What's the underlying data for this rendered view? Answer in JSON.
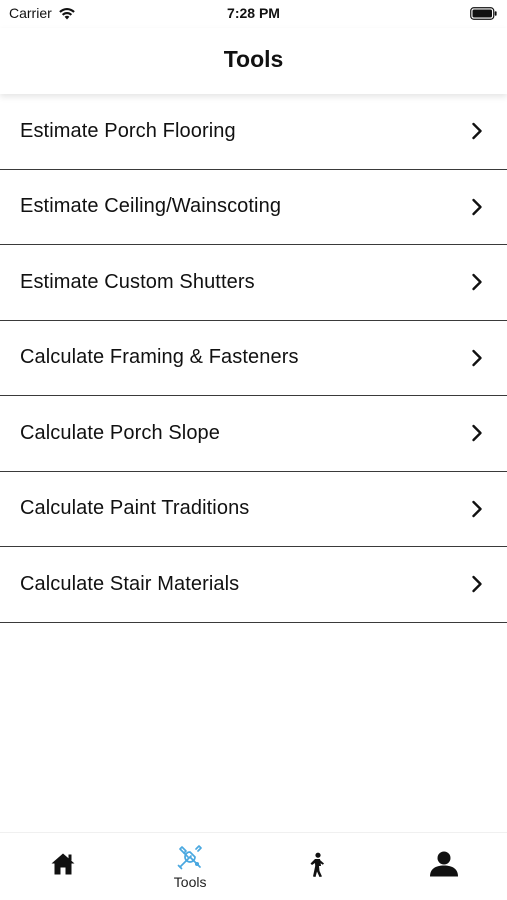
{
  "status_bar": {
    "carrier": "Carrier",
    "time": "7:28 PM"
  },
  "header": {
    "title": "Tools"
  },
  "tools": [
    {
      "label": "Estimate Porch Flooring"
    },
    {
      "label": "Estimate Ceiling/Wainscoting"
    },
    {
      "label": "Estimate Custom Shutters"
    },
    {
      "label": "Calculate Framing & Fasteners"
    },
    {
      "label": "Calculate Porch Slope"
    },
    {
      "label": "Calculate Paint Traditions"
    },
    {
      "label": "Calculate Stair Materials"
    }
  ],
  "tab_bar": {
    "tabs": [
      {
        "icon": "home-icon",
        "label": ""
      },
      {
        "icon": "tools-icon",
        "label": "Tools",
        "active": true
      },
      {
        "icon": "activity-icon",
        "label": ""
      },
      {
        "icon": "profile-icon",
        "label": ""
      }
    ]
  },
  "colors": {
    "accent": "#4aa8e0",
    "text": "#111111",
    "divider": "#3a3a3a"
  }
}
